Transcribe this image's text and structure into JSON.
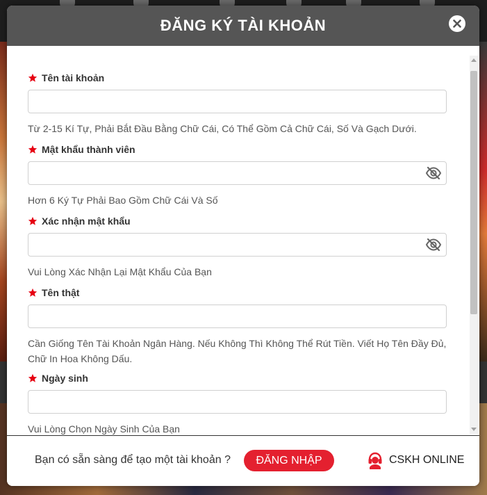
{
  "modal": {
    "title": "ĐĂNG KÝ TÀI KHOẢN",
    "close_icon": "close-circle-icon"
  },
  "form": {
    "fields": [
      {
        "label": "Tên tài khoản",
        "value": "",
        "hint": "Từ 2-15 Kí Tự, Phải Bắt Đầu Bằng Chữ Cái, Có Thể Gồm Cả Chữ Cái, Số Và Gạch Dưới."
      },
      {
        "label": "Mật khẩu thành viên",
        "value": "",
        "hint": "Hơn 6 Ký Tự Phải Bao Gồm Chữ Cái Và Số",
        "icon": "eye-slash-icon"
      },
      {
        "label": "Xác nhận mật khẩu",
        "value": "",
        "hint": "Vui Lòng Xác Nhận Lại Mật Khẩu Của Bạn",
        "icon": "eye-slash-icon"
      },
      {
        "label": "Tên thật",
        "value": "",
        "hint_line1": "Cần Giống Tên Tài Khoản Ngân Hàng. Nếu Không Thì Không Thể Rút Tiền. Viết Họ Tên Đầy Đủ,",
        "hint_line2": "Chữ In Hoa Không Dấu."
      },
      {
        "label": "Ngày sinh",
        "value": "",
        "hint": "Vui Lòng Chọn Ngày Sinh Của Bạn"
      }
    ],
    "required_icon": "star-icon"
  },
  "footer": {
    "prompt": "Bạn có sẵn sàng để tạo một tài khoản ?",
    "login_label": "ĐĂNG NHẬP",
    "support_label": "CSKH ONLINE",
    "support_icon": "headset-icon"
  },
  "colors": {
    "header_bg": "#555555",
    "accent_red": "#e4202f",
    "required_star": "#e60012"
  }
}
